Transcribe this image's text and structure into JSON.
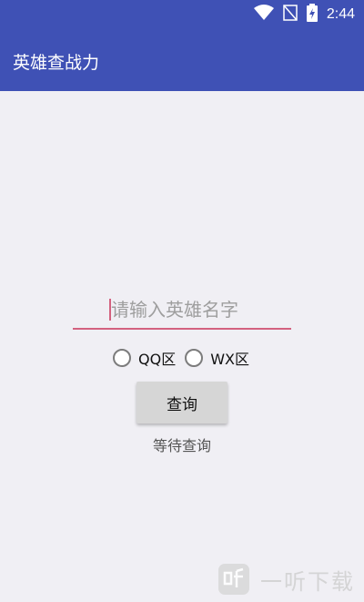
{
  "status_bar": {
    "time": "2:44",
    "icons": [
      "wifi-icon",
      "no-signal-icon",
      "battery-charging-icon"
    ]
  },
  "toolbar": {
    "title": "英雄查战力"
  },
  "search": {
    "placeholder": "请输入英雄名字",
    "value": ""
  },
  "region_options": [
    {
      "label": "QQ区",
      "selected": false
    },
    {
      "label": "WX区",
      "selected": false
    }
  ],
  "query_button": {
    "label": "查询"
  },
  "status_text": "等待查询",
  "watermark": {
    "text": "一听下载",
    "logo_glyph": "听"
  },
  "colors": {
    "primary": "#3f51b5",
    "accent": "#d3617f",
    "background": "#f0eff4",
    "button": "#d6d6d6"
  }
}
